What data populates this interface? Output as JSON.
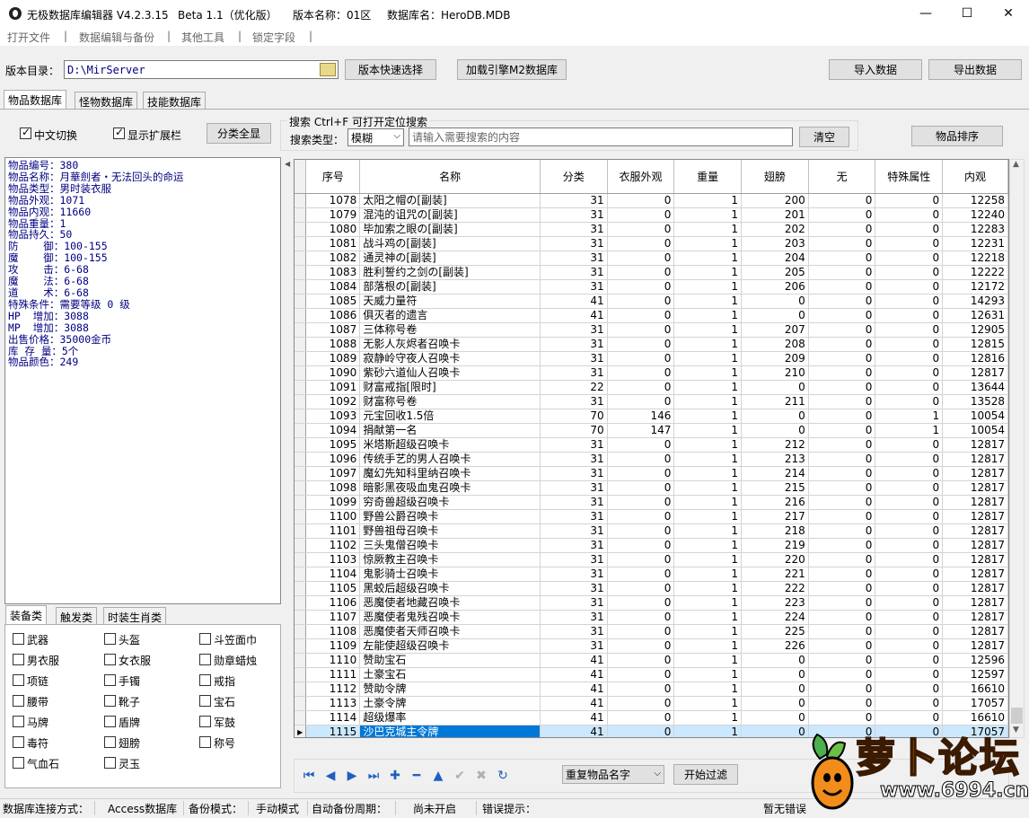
{
  "titlebar": {
    "app_name": "无极数据库编辑器 V4.2.3.15",
    "beta": "Beta 1.1（优化版）",
    "version_name": "版本名称：01区",
    "db_name": "数据库名：HeroDB.MDB",
    "minimize": "—",
    "maximize": "☐",
    "close": "✕"
  },
  "menu": [
    "打开文件",
    "数据编辑与备份",
    "其他工具",
    "锁定字段"
  ],
  "menu_separator": "|",
  "toolbar": {
    "dir_label": "版本目录：",
    "dir_value": "D:\\MirServer",
    "version_quick_select": "版本快速选择",
    "load_engine_db": "加载引擎M2数据库",
    "import": "导入数据",
    "export": "导出数据"
  },
  "tabs": [
    "物品数据库",
    "怪物数据库",
    "技能数据库"
  ],
  "options": {
    "chinese_switch": "中文切换",
    "show_ext": "显示扩展栏",
    "all_category": "分类全显",
    "search_title": "搜索  Ctrl+F 可打开定位搜索",
    "search_type_label": "搜索类型：",
    "search_type_value": "模糊",
    "search_placeholder": "请输入需要搜索的内容",
    "clear": "清空",
    "sort": "物品排序"
  },
  "info_lines": [
    "物品编号：380",
    "物品名称：月華劍者・无法回头的命运",
    "物品类型：男时装衣服",
    "物品外观：1071",
    "物品内观：11660",
    "物品重量：1",
    "物品持久：50",
    "防    御：100-155",
    "魔    御：100-155",
    "攻    击：6-68",
    "魔    法：6-68",
    "道    术：6-68",
    "特殊条件：需要等级 0 级",
    "HP  增加：3088",
    "MP  增加：3088",
    "出售价格：35000金币",
    "库 存 量：5个",
    "物品颜色：249"
  ],
  "category_tabs": [
    "装备类",
    "触发类",
    "时装生肖类"
  ],
  "categories": [
    [
      "武器",
      "头盔",
      "斗笠面巾"
    ],
    [
      "男衣服",
      "女衣服",
      "勋章蜡烛"
    ],
    [
      "项链",
      "手镯",
      "戒指"
    ],
    [
      "腰带",
      "靴子",
      "宝石"
    ],
    [
      "马牌",
      "盾牌",
      "军鼓"
    ],
    [
      "毒符",
      "翅膀",
      "称号"
    ],
    [
      "气血石",
      "灵玉",
      ""
    ]
  ],
  "grid": {
    "columns": [
      "序号",
      "名称",
      "分类",
      "衣服外观",
      "重量",
      "翅膀",
      "无",
      "特殊属性",
      "内观"
    ],
    "selected_index": 37,
    "rows": [
      [
        "1078",
        "太阳之帽の[副装]",
        "31",
        "0",
        "1",
        "200",
        "0",
        "0",
        "12258"
      ],
      [
        "1079",
        "混沌的诅咒の[副装]",
        "31",
        "0",
        "1",
        "201",
        "0",
        "0",
        "12240"
      ],
      [
        "1080",
        "毕加索之眼の[副装]",
        "31",
        "0",
        "1",
        "202",
        "0",
        "0",
        "12283"
      ],
      [
        "1081",
        "战斗鸡の[副装]",
        "31",
        "0",
        "1",
        "203",
        "0",
        "0",
        "12231"
      ],
      [
        "1082",
        "通灵神の[副装]",
        "31",
        "0",
        "1",
        "204",
        "0",
        "0",
        "12218"
      ],
      [
        "1083",
        "胜利誓约之剑の[副装]",
        "31",
        "0",
        "1",
        "205",
        "0",
        "0",
        "12222"
      ],
      [
        "1084",
        "部落根の[副装]",
        "31",
        "0",
        "1",
        "206",
        "0",
        "0",
        "12172"
      ],
      [
        "1085",
        "天威力量符",
        "41",
        "0",
        "1",
        "0",
        "0",
        "0",
        "14293"
      ],
      [
        "1086",
        "俱灭者的遗言",
        "41",
        "0",
        "1",
        "0",
        "0",
        "0",
        "12631"
      ],
      [
        "1087",
        "三体称号卷",
        "31",
        "0",
        "1",
        "207",
        "0",
        "0",
        "12905"
      ],
      [
        "1088",
        "无影人灰烬者召唤卡",
        "31",
        "0",
        "1",
        "208",
        "0",
        "0",
        "12815"
      ],
      [
        "1089",
        "寂静岭守夜人召唤卡",
        "31",
        "0",
        "1",
        "209",
        "0",
        "0",
        "12816"
      ],
      [
        "1090",
        "紫砂六道仙人召唤卡",
        "31",
        "0",
        "1",
        "210",
        "0",
        "0",
        "12817"
      ],
      [
        "1091",
        "财富戒指[限时]",
        "22",
        "0",
        "1",
        "0",
        "0",
        "0",
        "13644"
      ],
      [
        "1092",
        "财富称号卷",
        "31",
        "0",
        "1",
        "211",
        "0",
        "0",
        "13528"
      ],
      [
        "1093",
        "元宝回收1.5倍",
        "70",
        "146",
        "1",
        "0",
        "0",
        "1",
        "10054"
      ],
      [
        "1094",
        "捐献第一名",
        "70",
        "147",
        "1",
        "0",
        "0",
        "1",
        "10054"
      ],
      [
        "1095",
        "米塔斯超级召唤卡",
        "31",
        "0",
        "1",
        "212",
        "0",
        "0",
        "12817"
      ],
      [
        "1096",
        "传统手艺的男人召唤卡",
        "31",
        "0",
        "1",
        "213",
        "0",
        "0",
        "12817"
      ],
      [
        "1097",
        "魔幻先知科里纳召唤卡",
        "31",
        "0",
        "1",
        "214",
        "0",
        "0",
        "12817"
      ],
      [
        "1098",
        "暗影黑夜吸血鬼召唤卡",
        "31",
        "0",
        "1",
        "215",
        "0",
        "0",
        "12817"
      ],
      [
        "1099",
        "穷奇兽超级召唤卡",
        "31",
        "0",
        "1",
        "216",
        "0",
        "0",
        "12817"
      ],
      [
        "1100",
        "野兽公爵召唤卡",
        "31",
        "0",
        "1",
        "217",
        "0",
        "0",
        "12817"
      ],
      [
        "1101",
        "野兽祖母召唤卡",
        "31",
        "0",
        "1",
        "218",
        "0",
        "0",
        "12817"
      ],
      [
        "1102",
        "三头鬼僧召唤卡",
        "31",
        "0",
        "1",
        "219",
        "0",
        "0",
        "12817"
      ],
      [
        "1103",
        "惊厥教主召唤卡",
        "31",
        "0",
        "1",
        "220",
        "0",
        "0",
        "12817"
      ],
      [
        "1104",
        "鬼影骑士召唤卡",
        "31",
        "0",
        "1",
        "221",
        "0",
        "0",
        "12817"
      ],
      [
        "1105",
        "黑蛟后超级召唤卡",
        "31",
        "0",
        "1",
        "222",
        "0",
        "0",
        "12817"
      ],
      [
        "1106",
        "恶魔使者地藏召唤卡",
        "31",
        "0",
        "1",
        "223",
        "0",
        "0",
        "12817"
      ],
      [
        "1107",
        "恶魔使者鬼残召唤卡",
        "31",
        "0",
        "1",
        "224",
        "0",
        "0",
        "12817"
      ],
      [
        "1108",
        "恶魔使者天师召唤卡",
        "31",
        "0",
        "1",
        "225",
        "0",
        "0",
        "12817"
      ],
      [
        "1109",
        "左能使超级召唤卡",
        "31",
        "0",
        "1",
        "226",
        "0",
        "0",
        "12817"
      ],
      [
        "1110",
        "赞助宝石",
        "41",
        "0",
        "1",
        "0",
        "0",
        "0",
        "12596"
      ],
      [
        "1111",
        "土豪宝石",
        "41",
        "0",
        "1",
        "0",
        "0",
        "0",
        "12597"
      ],
      [
        "1112",
        "赞助令牌",
        "41",
        "0",
        "1",
        "0",
        "0",
        "0",
        "16610"
      ],
      [
        "1113",
        "土豪令牌",
        "41",
        "0",
        "1",
        "0",
        "0",
        "0",
        "17057"
      ],
      [
        "1114",
        "超级爆率",
        "41",
        "0",
        "1",
        "0",
        "0",
        "0",
        "16610"
      ],
      [
        "1115",
        "沙巴克城主令牌",
        "41",
        "0",
        "1",
        "0",
        "0",
        "0",
        "17057"
      ]
    ]
  },
  "nav": {
    "first": "⏮",
    "prev": "◀",
    "next": "▶",
    "last": "⏭",
    "add": "✚",
    "remove": "━",
    "up": "▲",
    "confirm": "✔",
    "cancel": "✖",
    "refresh": "↻"
  },
  "filter": {
    "select_value": "重复物品名字",
    "start": "开始过滤"
  },
  "status": {
    "conn_label": "数据库连接方式：",
    "conn_value": "Access数据库",
    "backup_label": "备份模式：",
    "backup_value": "手动模式",
    "auto_label": "自动备份周期：",
    "auto_value": "尚未开启",
    "error_label": "错误提示：",
    "error_value": "暂无错误"
  },
  "watermark": {
    "text": "萝卜论坛",
    "url": "www.6994.cn"
  },
  "colors": {
    "selected_cell": "#0078d7",
    "selected_row": "#cce8ff",
    "info_text": "#000080"
  }
}
